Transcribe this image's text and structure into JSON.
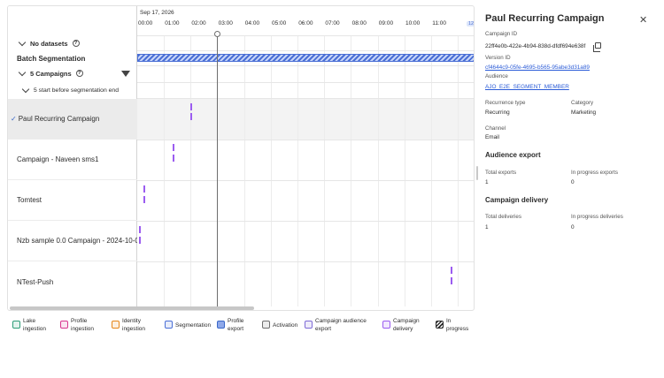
{
  "timeline": {
    "date": "Sep 17, 2026",
    "ticks": [
      "00:00",
      "01:00",
      "02:00",
      "03:00",
      "04:00",
      "05:00",
      "06:00",
      "07:00",
      "08:00",
      "09:00",
      "10:00",
      "11:00",
      "12:"
    ],
    "end_marker": "12:",
    "no_datasets_label": "No datasets",
    "batch_label": "Batch Segmentation",
    "campaigns_group_label": "5 Campaigns",
    "subgroup_label": "5 start before segmentation end",
    "campaigns": [
      {
        "name": "Paul Recurring Campaign",
        "selected": true
      },
      {
        "name": "Campaign - Naveen sms1",
        "selected": false
      },
      {
        "name": "Tomtest",
        "selected": false
      },
      {
        "name": "Nzb sample 0.0 Campaign - 2024-10-0...",
        "selected": false
      },
      {
        "name": "NTest-Push",
        "selected": false
      }
    ],
    "colors": {
      "batch": "#4a6fd6",
      "campaign_mark": "#9b5cf0"
    }
  },
  "legend": [
    {
      "label": "Lake\ningestion",
      "icon": "lake-ingestion-swatch",
      "color": "#2d9d78"
    },
    {
      "label": "Profile\ningestion",
      "icon": "profile-ingestion-swatch",
      "color": "#d83790"
    },
    {
      "label": "Identity\ningestion",
      "icon": "identity-ingestion-swatch",
      "color": "#e68619"
    },
    {
      "label": "Segmentation",
      "icon": "segmentation-swatch",
      "color": "#4a6fd6"
    },
    {
      "label": "Profile\nexport",
      "icon": "profile-export-swatch",
      "color": "#3a68c8"
    },
    {
      "label": "Activation",
      "icon": "activation-swatch",
      "color": "#6e6e6e"
    },
    {
      "label": "Campaign audience\nexport",
      "icon": "campaign-audience-export-swatch",
      "color": "#7e6bd6"
    },
    {
      "label": "Campaign\ndelivery",
      "icon": "campaign-delivery-swatch",
      "color": "#9b5cf0"
    },
    {
      "label": "In\nprogress",
      "icon": "in-progress-swatch",
      "color": "#2c2c2c"
    }
  ],
  "details": {
    "title": "Paul Recurring Campaign",
    "campaign_id_label": "Campaign ID",
    "campaign_id": "22ff4e0b-422e-4b94-838d-dfdf694e638f",
    "version_id_label": "Version ID",
    "version_id": "cf4644c9-05fe-4695-b565-95abe3d31a89",
    "audience_label": "Audience",
    "audience": "AJO_E2E_SEGMENT_MEMBER",
    "recurrence_type_label": "Recurrence type",
    "recurrence_type": "Recurring",
    "category_label": "Category",
    "category": "Marketing",
    "channel_label": "Channel",
    "channel": "Email",
    "audience_export_heading": "Audience export",
    "total_exports_label": "Total exports",
    "total_exports": "1",
    "in_progress_exports_label": "In progress exports",
    "in_progress_exports": "0",
    "campaign_delivery_heading": "Campaign delivery",
    "total_deliveries_label": "Total deliveries",
    "total_deliveries": "1",
    "in_progress_deliveries_label": "In progress deliveries",
    "in_progress_deliveries": "0"
  }
}
